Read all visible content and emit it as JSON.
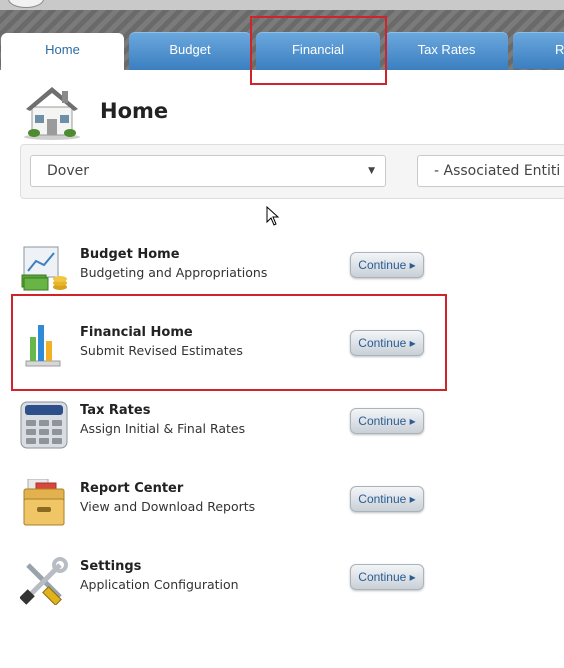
{
  "nav": {
    "tabs": [
      {
        "label": "Home",
        "active": true
      },
      {
        "label": "Budget"
      },
      {
        "label": "Financial"
      },
      {
        "label": "Tax Rates"
      },
      {
        "label": "Re"
      }
    ]
  },
  "page": {
    "title": "Home",
    "icon": "house-icon"
  },
  "filters": {
    "municipality": "Dover",
    "entities": "- Associated Entiti"
  },
  "items": [
    {
      "title": "Budget Home",
      "subtitle": "Budgeting and Appropriations",
      "button": "Continue ▸",
      "icon": "budget-chart-money-icon"
    },
    {
      "title": "Financial Home",
      "subtitle": "Submit Revised Estimates",
      "button": "Continue ▸",
      "icon": "bar-chart-icon"
    },
    {
      "title": "Tax Rates",
      "subtitle": "Assign Initial & Final Rates",
      "button": "Continue ▸",
      "icon": "calculator-icon"
    },
    {
      "title": "Report Center",
      "subtitle": "View and Download Reports",
      "button": "Continue ▸",
      "icon": "file-drawer-icon"
    },
    {
      "title": "Settings",
      "subtitle": "Application Configuration",
      "button": "Continue ▸",
      "icon": "tools-icon"
    }
  ],
  "colors": {
    "highlight": "#d0242b",
    "tab_blue": "#3b7fc1",
    "link_blue": "#2a5d93"
  }
}
